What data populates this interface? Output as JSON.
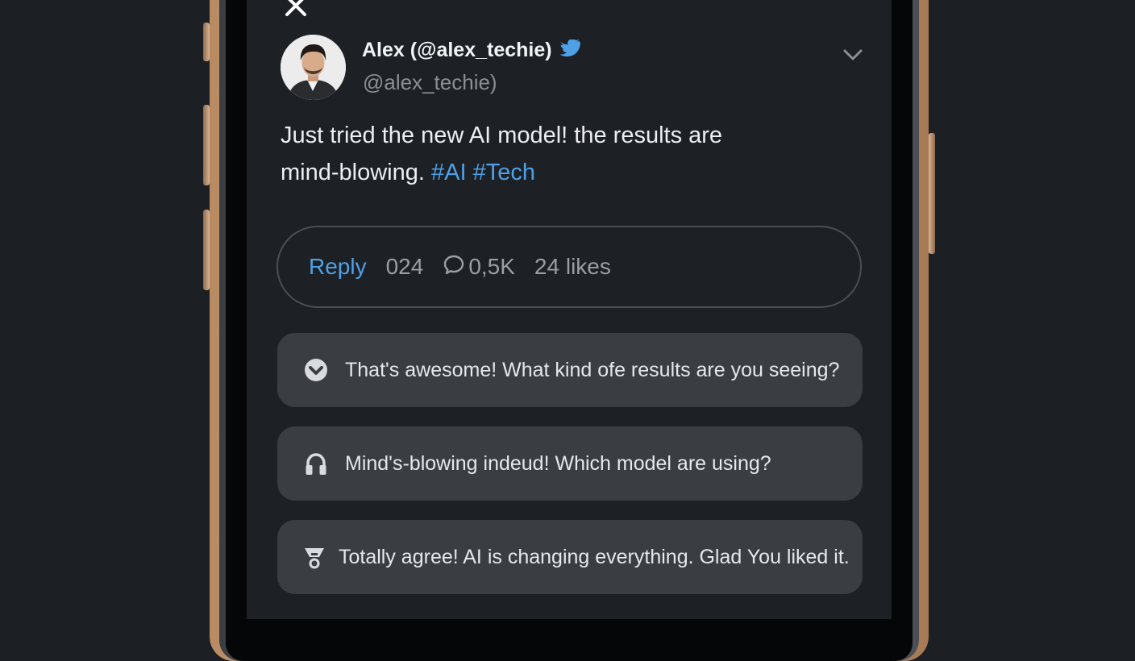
{
  "tweet": {
    "author_name": "Alex (@alex_techie)",
    "handle": "@alex_techie)",
    "text_line1": "Just tried the new AI model! the results are",
    "text_line2_prefix": "mind-blowing.",
    "hashtags": [
      "#AI",
      "#Tech"
    ],
    "verified_icon": "twitter-bird-icon"
  },
  "actions": {
    "reply_label": "Reply",
    "retweets": "024",
    "comments": "0,5K",
    "likes": "24 likes"
  },
  "suggestions": [
    {
      "icon": "chat-check-icon",
      "text": "That's awesome! What kind ofe results are you seeing?"
    },
    {
      "icon": "headphones-icon",
      "text": "Mind's-blowing indeud! Which model are using?"
    },
    {
      "icon": "trophy-icon",
      "text": "Totally agree! AI is changing everything. Glad You liked it."
    }
  ],
  "colors": {
    "accent": "#4ea1e6",
    "background": "#1d2025",
    "card": "#3a3d42",
    "frame_gold": "#d9b493"
  }
}
